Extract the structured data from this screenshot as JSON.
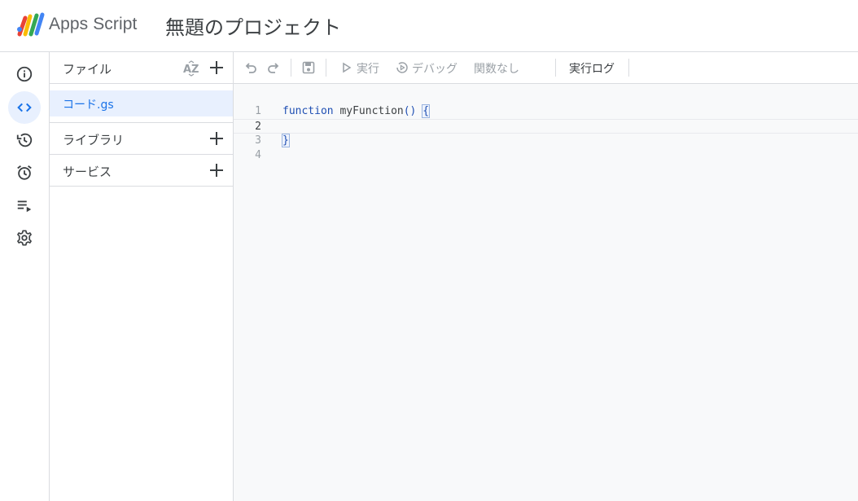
{
  "header": {
    "app_name": "Apps Script",
    "project_title": "無題のプロジェクト"
  },
  "rail": {
    "items": [
      {
        "icon": "info-icon"
      },
      {
        "icon": "code-icon",
        "active": true
      },
      {
        "icon": "history-icon"
      },
      {
        "icon": "alarm-icon"
      },
      {
        "icon": "playlist-icon"
      },
      {
        "icon": "gear-icon"
      }
    ]
  },
  "files_panel": {
    "files_label": "ファイル",
    "file_name": "コード.gs",
    "libraries_label": "ライブラリ",
    "services_label": "サービス"
  },
  "toolbar": {
    "run_label": "実行",
    "debug_label": "デバッグ",
    "function_select": "関数なし",
    "log_label": "実行ログ"
  },
  "editor": {
    "lines": [
      {
        "number": "1",
        "keyword": "function",
        "name": " myFunction",
        "parens": "()",
        "space": " ",
        "brace": "{"
      },
      {
        "number": "2"
      },
      {
        "number": "3",
        "brace": "}"
      },
      {
        "number": "4"
      }
    ]
  },
  "colors": {
    "accent": "#1a73e8",
    "active_bg": "#e8f0fe",
    "border": "#dadce0",
    "editor_bg": "#f8f9fa"
  }
}
